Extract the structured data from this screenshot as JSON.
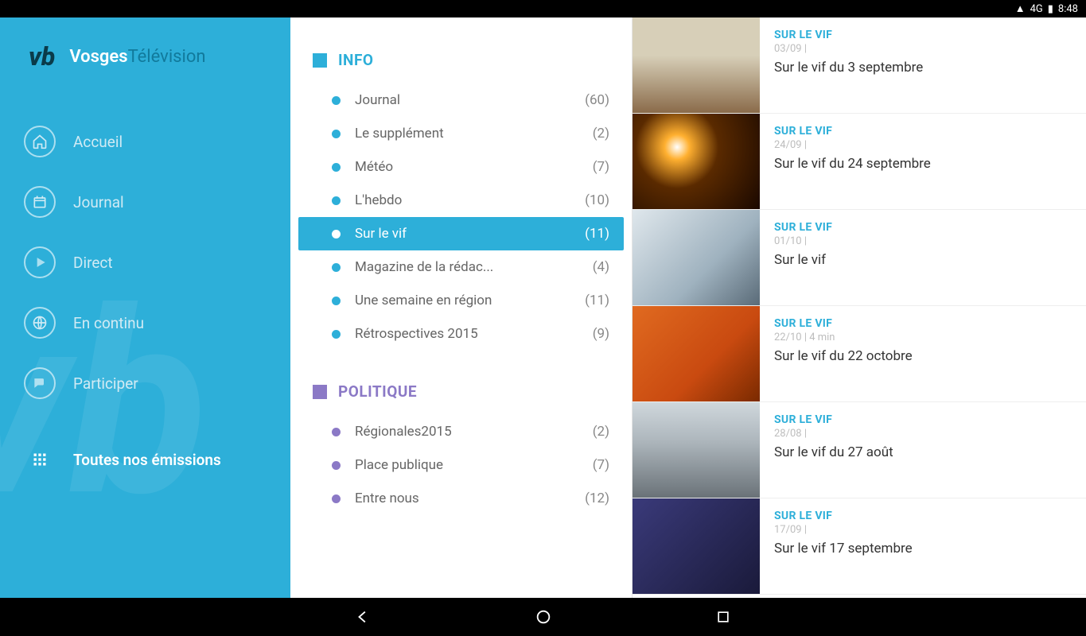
{
  "status": {
    "time": "8:48",
    "network": "4G"
  },
  "brand": {
    "logo": "vb",
    "part1": "Vosges",
    "part2": "Télévision"
  },
  "nav": [
    {
      "id": "accueil",
      "label": "Accueil",
      "active": false
    },
    {
      "id": "journal",
      "label": "Journal",
      "active": false
    },
    {
      "id": "direct",
      "label": "Direct",
      "active": false
    },
    {
      "id": "encontinu",
      "label": "En continu",
      "active": false
    },
    {
      "id": "participer",
      "label": "Participer",
      "active": false
    },
    {
      "id": "emissions",
      "label": "Toutes nos émissions",
      "active": true
    }
  ],
  "sections": [
    {
      "id": "info",
      "title": "INFO",
      "colorClass": "info",
      "items": [
        {
          "label": "Journal",
          "count": "(60)",
          "selected": false
        },
        {
          "label": "Le supplément",
          "count": "(2)",
          "selected": false
        },
        {
          "label": "Météo",
          "count": "(7)",
          "selected": false
        },
        {
          "label": "L'hebdo",
          "count": "(10)",
          "selected": false
        },
        {
          "label": "Sur le vif",
          "count": "(11)",
          "selected": true
        },
        {
          "label": "Magazine de la rédac...",
          "count": "(4)",
          "selected": false
        },
        {
          "label": "Une semaine en région",
          "count": "(11)",
          "selected": false
        },
        {
          "label": "Rétrospectives 2015",
          "count": "(9)",
          "selected": false
        }
      ]
    },
    {
      "id": "politique",
      "title": "POLITIQUE",
      "colorClass": "politique",
      "items": [
        {
          "label": "Régionales2015",
          "count": "(2)",
          "selected": false
        },
        {
          "label": "Place publique",
          "count": "(7)",
          "selected": false
        },
        {
          "label": "Entre nous",
          "count": "(12)",
          "selected": false
        }
      ]
    }
  ],
  "videos": [
    {
      "category": "SUR LE VIF",
      "date": "03/09 |",
      "title": "Sur le vif du 3 septembre"
    },
    {
      "category": "SUR LE VIF",
      "date": "24/09 |",
      "title": "Sur le vif du 24 septembre"
    },
    {
      "category": "SUR LE VIF",
      "date": "01/10 |",
      "title": "Sur le vif"
    },
    {
      "category": "SUR LE VIF",
      "date": "22/10 | 4 min",
      "title": "Sur le vif du 22 octobre"
    },
    {
      "category": "SUR LE VIF",
      "date": "28/08 |",
      "title": "Sur le vif du 27 août"
    },
    {
      "category": "SUR LE VIF",
      "date": "17/09 |",
      "title": "Sur le vif 17 septembre"
    }
  ],
  "colors": {
    "accent": "#2dafd9",
    "politique": "#8b79c6"
  }
}
